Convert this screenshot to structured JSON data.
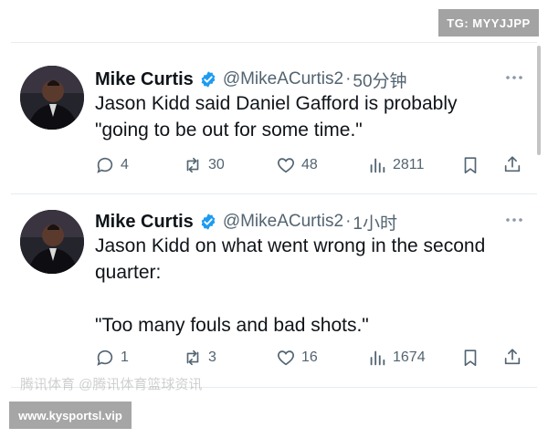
{
  "overlay": {
    "tg_label": "TG: MYYJJPP",
    "site_label": "www.kysportsl.vip",
    "watermark_text": "腾讯体育 @腾讯体育篮球资讯"
  },
  "colors": {
    "verified_blue": "#1d9bf0",
    "text_primary": "#0f1419",
    "text_secondary": "#536471"
  },
  "tweets": [
    {
      "author_name": "Mike Curtis",
      "handle": "@MikeACurtis2",
      "separator": "·",
      "time": "50分钟",
      "verified": true,
      "body": [
        "Jason Kidd said Daniel Gafford is probably",
        "\"going to be out for some time.\""
      ],
      "replies": "4",
      "reposts": "30",
      "likes": "48",
      "views": "2811",
      "icons": [
        "reply-icon",
        "repost-icon",
        "like-icon",
        "views-icon",
        "bookmark-icon",
        "share-icon"
      ]
    },
    {
      "author_name": "Mike Curtis",
      "handle": "@MikeACurtis2",
      "separator": "·",
      "time": "1小时",
      "verified": true,
      "body": [
        "Jason Kidd on what went wrong in the second",
        "quarter:",
        "",
        "\"Too many fouls and bad shots.\""
      ],
      "replies": "1",
      "reposts": "3",
      "likes": "16",
      "views": "1674",
      "icons": [
        "reply-icon",
        "repost-icon",
        "like-icon",
        "views-icon",
        "bookmark-icon",
        "share-icon"
      ]
    }
  ]
}
